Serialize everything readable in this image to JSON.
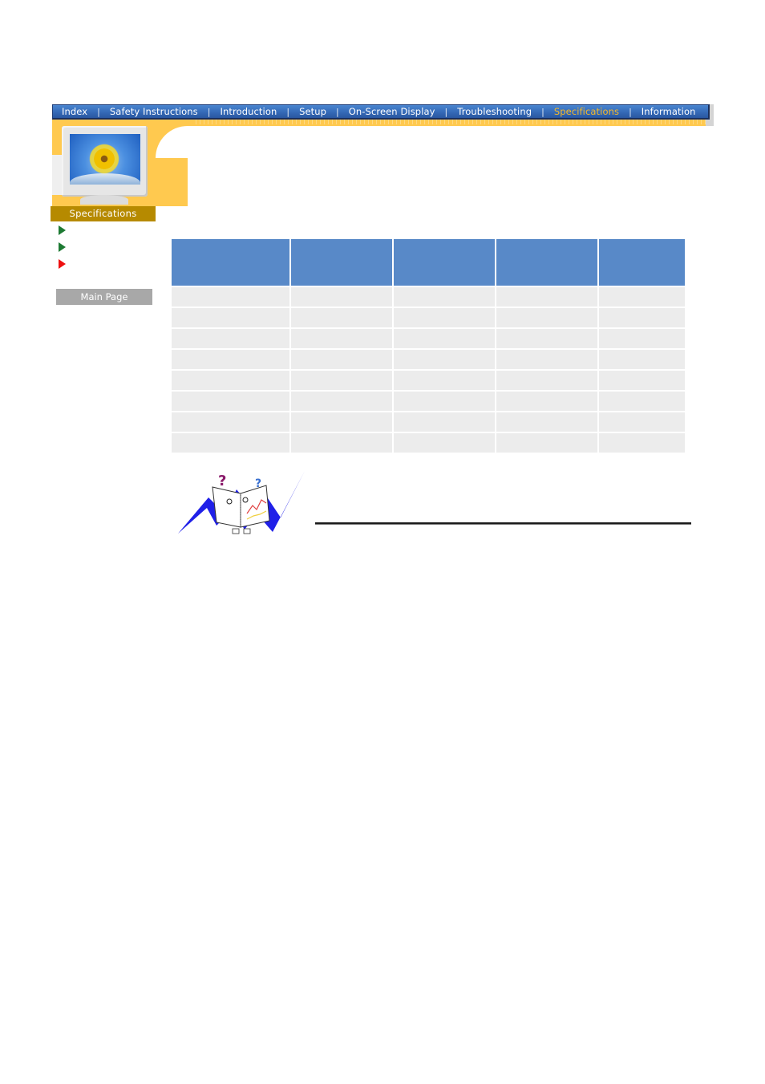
{
  "nav": {
    "items": [
      {
        "label": "Index",
        "active": false
      },
      {
        "label": "Safety Instructions",
        "active": false
      },
      {
        "label": "Introduction",
        "active": false
      },
      {
        "label": "Setup",
        "active": false
      },
      {
        "label": "On-Screen Display",
        "active": false
      },
      {
        "label": "Troubleshooting",
        "active": false
      },
      {
        "label": "Specifications",
        "active": true
      },
      {
        "label": "Information",
        "active": false
      }
    ],
    "separator": "|",
    "colors": {
      "bar": "#3367b5",
      "text": "#ffffff",
      "active_text": "#f5b82a"
    }
  },
  "sidebar": {
    "section_label": "Specifications",
    "arrow_links": [
      {
        "label": "",
        "color": "#1d7a33"
      },
      {
        "label": "",
        "color": "#1d7a33"
      },
      {
        "label": "",
        "color": "#ee1010"
      }
    ],
    "main_page_label": "Main Page"
  },
  "table": {
    "header_color": "#5889c8",
    "row_color": "#ececec",
    "columns": [
      "",
      "",
      "",
      "",
      ""
    ],
    "rows": [
      [
        "",
        "",
        "",
        "",
        ""
      ],
      [
        "",
        "",
        "",
        "",
        ""
      ],
      [
        "",
        "",
        "",
        "",
        ""
      ],
      [
        "",
        "",
        "",
        "",
        ""
      ],
      [
        "",
        "",
        "",
        "",
        ""
      ],
      [
        "",
        "",
        "",
        "",
        ""
      ],
      [
        "",
        "",
        "",
        "",
        ""
      ],
      [
        "",
        "",
        "",
        "",
        ""
      ]
    ]
  },
  "note": {
    "illustration": "confused-book-mascot",
    "text": ""
  },
  "theme": {
    "frame_color": "#ffc94f",
    "label_bar_color": "#b68a00"
  }
}
